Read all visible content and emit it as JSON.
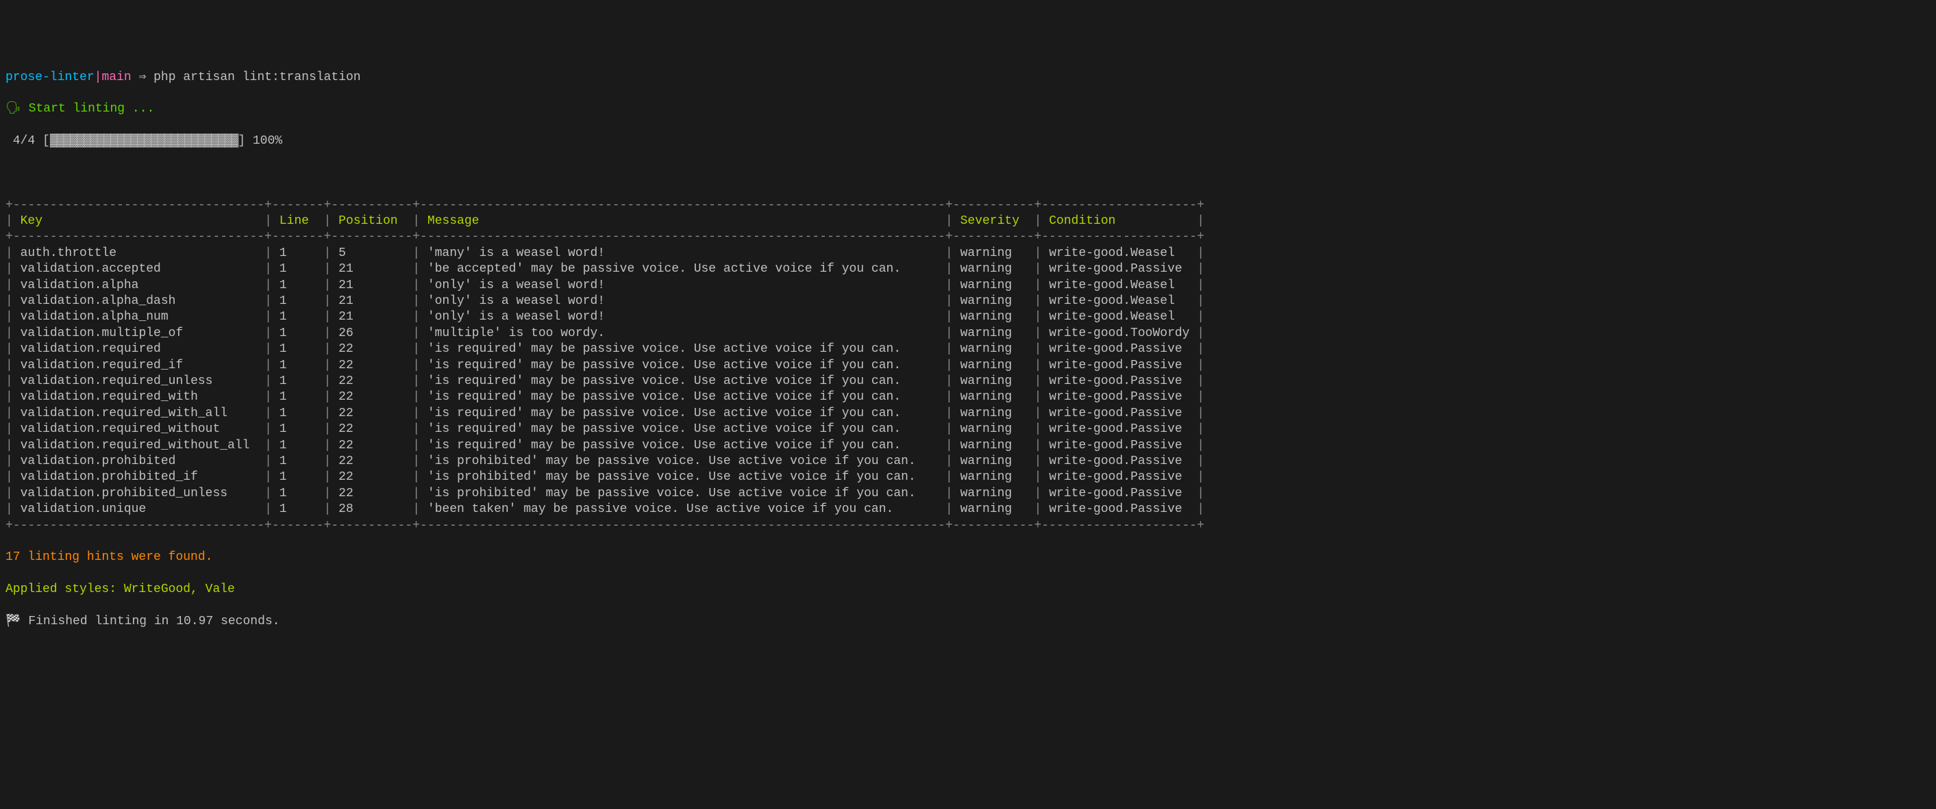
{
  "prompt": {
    "project": "prose-linter",
    "separator": "|",
    "branch": "main",
    "arrow": " ⇒ ",
    "command": "php artisan lint:translation"
  },
  "start": {
    "icon": "🗣",
    "text": " Start linting ..."
  },
  "progress": {
    "count": " 4/4 [",
    "bar_fill": "▓▓▓▓▓▓▓▓▓▓▓▓▓▓▓▓▓▓▓▓▓▓▓▓▓▓▓▓",
    "bar_end": "] ",
    "percent": "100%"
  },
  "table": {
    "headers": {
      "key": "Key",
      "line": "Line",
      "position": "Position",
      "message": "Message",
      "severity": "Severity",
      "condition": "Condition"
    },
    "rows": [
      {
        "key": "auth.throttle",
        "line": "1",
        "position": "5",
        "message": "'many' is a weasel word!",
        "severity": "warning",
        "condition": "write-good.Weasel"
      },
      {
        "key": "validation.accepted",
        "line": "1",
        "position": "21",
        "message": "'be accepted' may be passive voice. Use active voice if you can.",
        "severity": "warning",
        "condition": "write-good.Passive"
      },
      {
        "key": "validation.alpha",
        "line": "1",
        "position": "21",
        "message": "'only' is a weasel word!",
        "severity": "warning",
        "condition": "write-good.Weasel"
      },
      {
        "key": "validation.alpha_dash",
        "line": "1",
        "position": "21",
        "message": "'only' is a weasel word!",
        "severity": "warning",
        "condition": "write-good.Weasel"
      },
      {
        "key": "validation.alpha_num",
        "line": "1",
        "position": "21",
        "message": "'only' is a weasel word!",
        "severity": "warning",
        "condition": "write-good.Weasel"
      },
      {
        "key": "validation.multiple_of",
        "line": "1",
        "position": "26",
        "message": "'multiple' is too wordy.",
        "severity": "warning",
        "condition": "write-good.TooWordy"
      },
      {
        "key": "validation.required",
        "line": "1",
        "position": "22",
        "message": "'is required' may be passive voice. Use active voice if you can.",
        "severity": "warning",
        "condition": "write-good.Passive"
      },
      {
        "key": "validation.required_if",
        "line": "1",
        "position": "22",
        "message": "'is required' may be passive voice. Use active voice if you can.",
        "severity": "warning",
        "condition": "write-good.Passive"
      },
      {
        "key": "validation.required_unless",
        "line": "1",
        "position": "22",
        "message": "'is required' may be passive voice. Use active voice if you can.",
        "severity": "warning",
        "condition": "write-good.Passive"
      },
      {
        "key": "validation.required_with",
        "line": "1",
        "position": "22",
        "message": "'is required' may be passive voice. Use active voice if you can.",
        "severity": "warning",
        "condition": "write-good.Passive"
      },
      {
        "key": "validation.required_with_all",
        "line": "1",
        "position": "22",
        "message": "'is required' may be passive voice. Use active voice if you can.",
        "severity": "warning",
        "condition": "write-good.Passive"
      },
      {
        "key": "validation.required_without",
        "line": "1",
        "position": "22",
        "message": "'is required' may be passive voice. Use active voice if you can.",
        "severity": "warning",
        "condition": "write-good.Passive"
      },
      {
        "key": "validation.required_without_all",
        "line": "1",
        "position": "22",
        "message": "'is required' may be passive voice. Use active voice if you can.",
        "severity": "warning",
        "condition": "write-good.Passive"
      },
      {
        "key": "validation.prohibited",
        "line": "1",
        "position": "22",
        "message": "'is prohibited' may be passive voice. Use active voice if you can.",
        "severity": "warning",
        "condition": "write-good.Passive"
      },
      {
        "key": "validation.prohibited_if",
        "line": "1",
        "position": "22",
        "message": "'is prohibited' may be passive voice. Use active voice if you can.",
        "severity": "warning",
        "condition": "write-good.Passive"
      },
      {
        "key": "validation.prohibited_unless",
        "line": "1",
        "position": "22",
        "message": "'is prohibited' may be passive voice. Use active voice if you can.",
        "severity": "warning",
        "condition": "write-good.Passive"
      },
      {
        "key": "validation.unique",
        "line": "1",
        "position": "28",
        "message": "'been taken' may be passive voice. Use active voice if you can.",
        "severity": "warning",
        "condition": "write-good.Passive"
      }
    ]
  },
  "summary": {
    "hints": "17 linting hints were found.",
    "applied_label": "Applied styles: ",
    "applied_styles": "WriteGood, Vale",
    "finished_icon": "🏁",
    "finished_text": " Finished linting in 10.97 seconds."
  },
  "widths": {
    "key": 32,
    "line": 5,
    "position": 9,
    "message": 69,
    "severity": 9,
    "condition": 19
  }
}
